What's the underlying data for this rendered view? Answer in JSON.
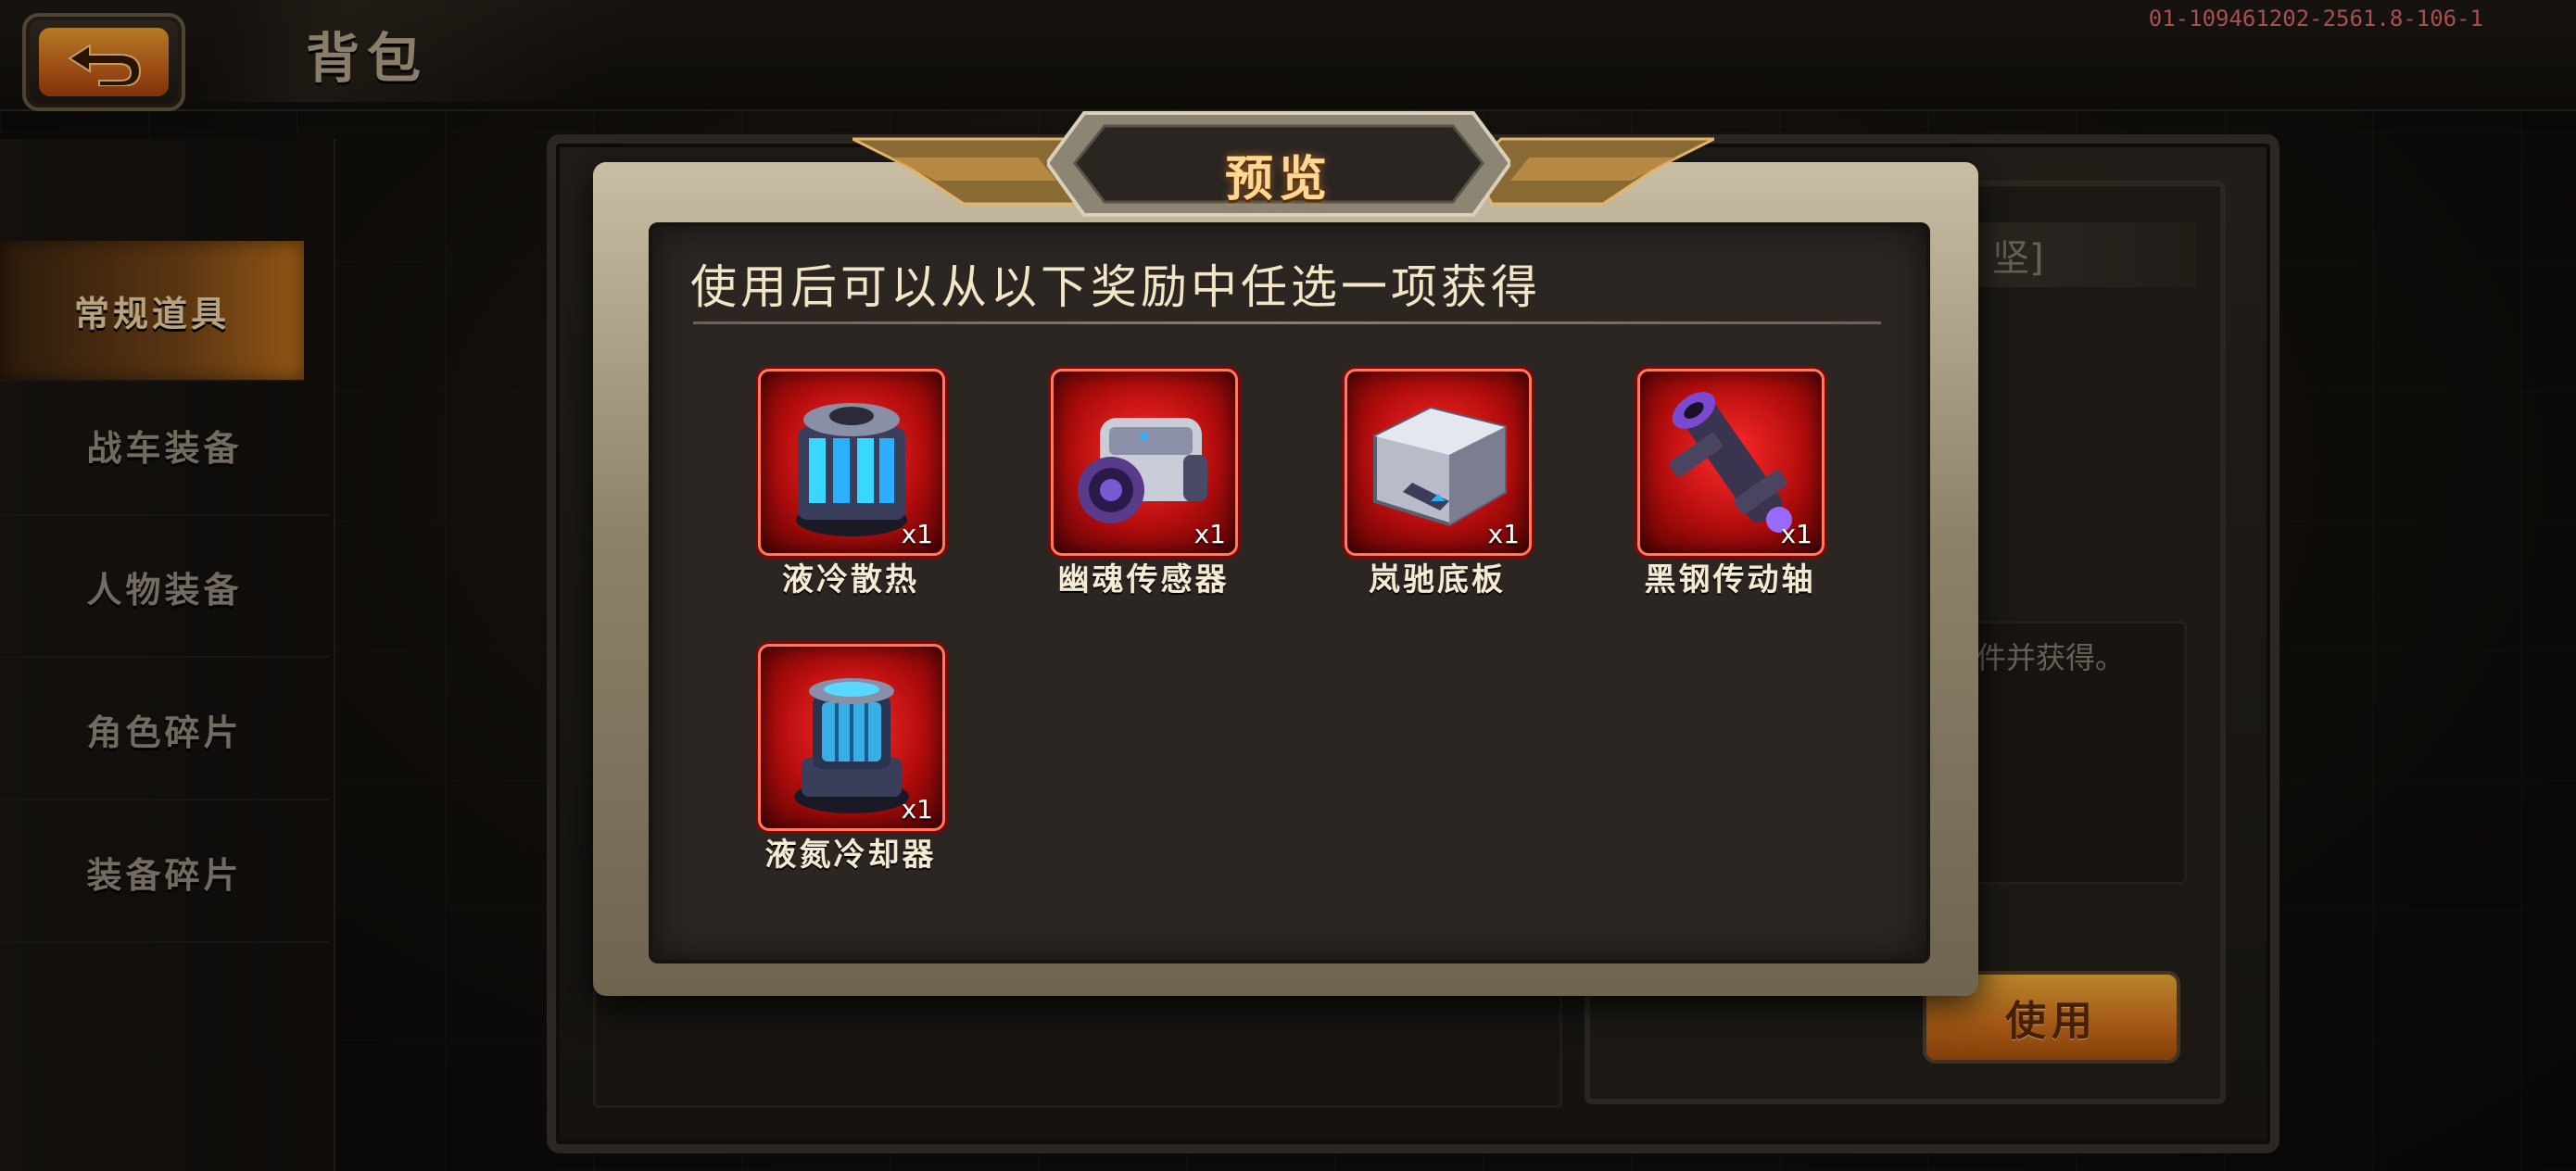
{
  "header": {
    "title": "背包",
    "version": "01-109461202-2561.8-106-1"
  },
  "sidebar": {
    "items": [
      {
        "label": "常规道具",
        "active": true
      },
      {
        "label": "战车装备",
        "active": false
      },
      {
        "label": "人物装备",
        "active": false
      },
      {
        "label": "角色碎片",
        "active": false
      },
      {
        "label": "装备碎片",
        "active": false
      }
    ]
  },
  "detail": {
    "name_fragment": "坚]",
    "desc_fragment": "件并获得。",
    "use_label": "使用"
  },
  "modal": {
    "title": "预览",
    "subtitle": "使用后可以从以下奖励中任选一项获得",
    "rewards": [
      {
        "name": "液冷散热",
        "count": "x1",
        "icon": "liquid-cooling-radiator-icon"
      },
      {
        "name": "幽魂传感器",
        "count": "x1",
        "icon": "ghost-sensor-icon"
      },
      {
        "name": "岚驰底板",
        "count": "x1",
        "icon": "chassis-plate-icon"
      },
      {
        "name": "黑钢传动轴",
        "count": "x1",
        "icon": "drive-shaft-icon"
      },
      {
        "name": "液氮冷却器",
        "count": "x1",
        "icon": "liquid-nitrogen-cooler-icon"
      }
    ]
  },
  "colors": {
    "accent_orange": "#dd7a1e",
    "reward_frame_red": "#b30d0d",
    "title_gold": "#ffd994"
  }
}
